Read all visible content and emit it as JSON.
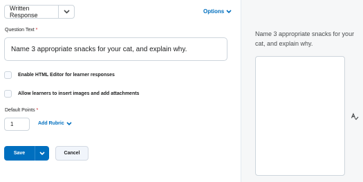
{
  "question_type": {
    "selected": "Written Response",
    "icon": "chevron-down-icon"
  },
  "options_link": {
    "label": "Options",
    "icon": "chevron-down-icon",
    "color": "#006fbf"
  },
  "question_text": {
    "label": "Question Text",
    "required_mark": "*",
    "value": "Name 3 appropriate snacks for your cat, and explain why."
  },
  "checkboxes": [
    {
      "label": "Enable HTML Editor for learner responses",
      "checked": false
    },
    {
      "label": "Allow learners to insert images and add attachments",
      "checked": false
    }
  ],
  "default_points": {
    "label": "Default Points",
    "required_mark": "*",
    "value": "1"
  },
  "add_rubric": {
    "label": "Add Rubric",
    "icon": "chevron-down-icon"
  },
  "buttons": {
    "save": "Save",
    "cancel": "Cancel"
  },
  "preview": {
    "question": "Name 3 appropriate snacks for your cat, and explain why.",
    "response_value": "",
    "icon": "spell-check-icon"
  },
  "colors": {
    "accent": "#006fbf",
    "required": "#cd2026",
    "preview_bg": "#f6f7f8"
  }
}
